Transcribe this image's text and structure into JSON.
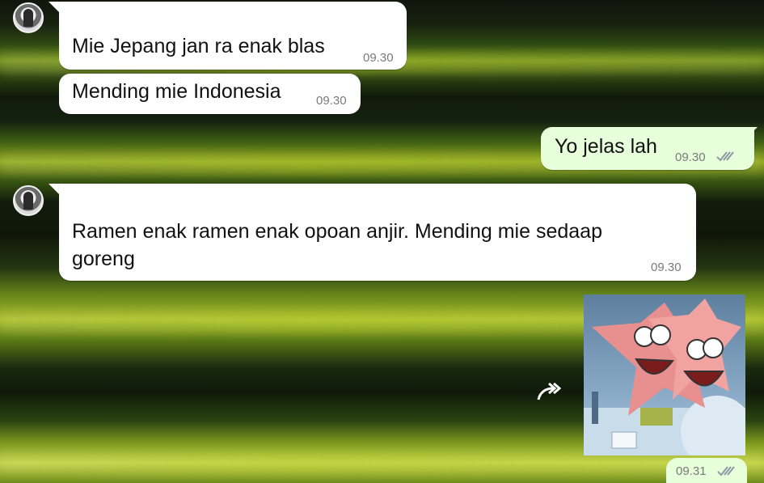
{
  "messages": [
    {
      "text": "Mie Jepang jan ra enak blas",
      "time": "09.30",
      "direction": "incoming"
    },
    {
      "text": "Mending mie Indonesia",
      "time": "09.30",
      "direction": "incoming"
    },
    {
      "text": "Yo jelas lah",
      "time": "09.30",
      "direction": "outgoing",
      "status": "read"
    },
    {
      "text": "Ramen enak ramen enak opoan anjir. Mending mie sedaap goreng",
      "time": "09.30",
      "direction": "incoming"
    },
    {
      "type": "sticker",
      "description_icon": "patrick-star-sticker",
      "direction": "outgoing"
    },
    {
      "time": "09.31",
      "direction": "outgoing",
      "status": "read"
    }
  ],
  "icons": {
    "forward": "forward-icon",
    "read": "double-check-icon",
    "avatar": "contact-avatar"
  },
  "colors": {
    "incoming_bubble": "#ffffff",
    "outgoing_bubble": "#e7ffdb",
    "read_ticks": "#8a9aa5"
  }
}
